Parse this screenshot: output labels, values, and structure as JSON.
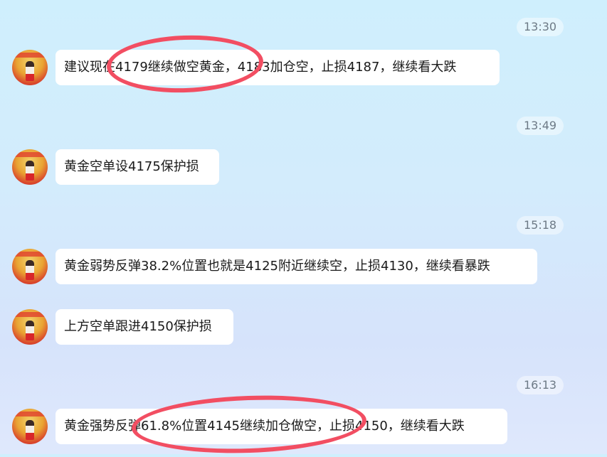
{
  "messages": [
    {
      "time": "13:30",
      "text": "建议现在4179继续做空黄金，4183加仓空，止损4187，继续看大跌"
    },
    {
      "time": "13:49",
      "text": "黄金空单设4175保护损"
    },
    {
      "time": "15:18",
      "text": "黄金弱势反弹38.2%位置也就是4125附近继续空，止损4130，继续看暴跌"
    },
    {
      "time": "",
      "text": "上方空单跟进4150保护损"
    },
    {
      "time": "16:13",
      "text": "黄金强势反弹61.8%位置4145继续加仓做空，止损4150，继续看大跌"
    }
  ],
  "colors": {
    "highlight_ring": "#f24e62",
    "bubble": "#ffffff"
  }
}
